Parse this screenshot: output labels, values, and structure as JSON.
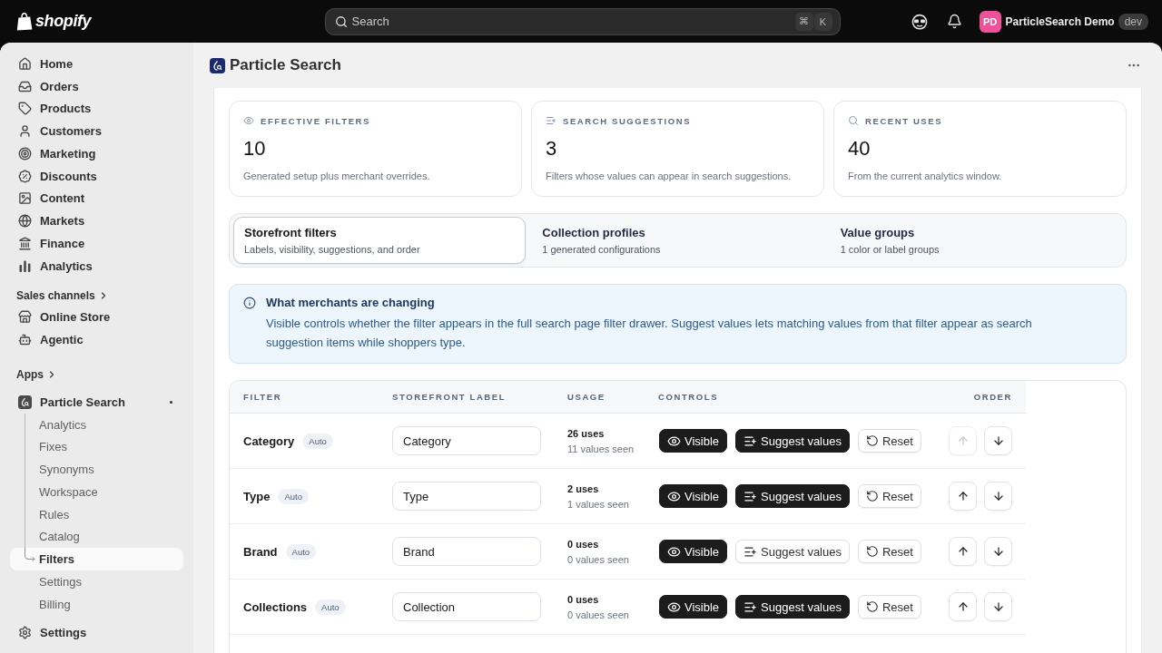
{
  "top_bar": {
    "logo": "shopify",
    "search": {
      "placeholder": "Search",
      "shortcut": [
        "⌘",
        "K"
      ]
    },
    "account": {
      "initials": "PD",
      "name": "ParticleSearch Demo",
      "badge": "dev"
    }
  },
  "sidebar": {
    "nav": [
      {
        "label": "Home",
        "selected": false
      },
      {
        "label": "Orders",
        "selected": false
      },
      {
        "label": "Products",
        "selected": false
      },
      {
        "label": "Customers",
        "selected": false
      },
      {
        "label": "Marketing",
        "selected": false
      },
      {
        "label": "Discounts",
        "selected": false
      },
      {
        "label": "Content",
        "selected": false
      },
      {
        "label": "Markets",
        "selected": false
      },
      {
        "label": "Finance",
        "selected": false
      },
      {
        "label": "Analytics",
        "selected": false
      }
    ],
    "sales_channels": {
      "heading": "Sales channels",
      "items": [
        {
          "label": "Online Store",
          "selected": false
        },
        {
          "label": "Agentic",
          "selected": false
        }
      ]
    },
    "apps": {
      "heading": "Apps",
      "items": [
        {
          "label": "Particle Search",
          "selected": false,
          "children": [
            {
              "label": "Analytics",
              "selected": false
            },
            {
              "label": "Fixes",
              "selected": false
            },
            {
              "label": "Synonyms",
              "selected": false
            },
            {
              "label": "Workspace",
              "selected": false
            },
            {
              "label": "Rules",
              "selected": false
            },
            {
              "label": "Catalog",
              "selected": false
            },
            {
              "label": "Filters",
              "selected": true
            },
            {
              "label": "Settings",
              "selected": false
            },
            {
              "label": "Billing",
              "selected": false
            }
          ]
        }
      ]
    },
    "footer": {
      "label": "Settings",
      "selected": false
    }
  },
  "page": {
    "title": "Particle Search"
  },
  "stats": [
    {
      "label": "EFFECTIVE FILTERS",
      "value": "10",
      "description": "Generated setup plus merchant overrides."
    },
    {
      "label": "SEARCH SUGGESTIONS",
      "value": "3",
      "description": "Filters whose values can appear in search suggestions."
    },
    {
      "label": "RECENT USES",
      "value": "40",
      "description": "From the current analytics window."
    }
  ],
  "tabs": [
    {
      "title": "Storefront filters",
      "subtitle": "Labels, visibility, suggestions, and order",
      "selected": true
    },
    {
      "title": "Collection profiles",
      "subtitle": "1 generated configurations",
      "selected": false
    },
    {
      "title": "Value groups",
      "subtitle": "1 color or label groups",
      "selected": false
    }
  ],
  "banner": {
    "title": "What merchants are changing",
    "body": "Visible controls whether the filter appears in the full search page filter drawer. Suggest values lets matching values from that filter appear as search suggestion items while shoppers type."
  },
  "table": {
    "columns": [
      "FILTER",
      "STOREFRONT LABEL",
      "USAGE",
      "CONTROLS",
      "ORDER"
    ],
    "rows": [
      {
        "filter": "Category",
        "badge": "Auto",
        "label": "Category",
        "uses": "26 uses",
        "values_seen": "11 values seen",
        "controls": [
          {
            "kind": "visible",
            "label": "Visible",
            "on": true
          },
          {
            "kind": "suggest",
            "label": "Suggest values",
            "on": true
          },
          {
            "kind": "reset",
            "label": "Reset"
          }
        ],
        "up_disabled": true
      },
      {
        "filter": "Type",
        "badge": "Auto",
        "label": "Type",
        "uses": "2 uses",
        "values_seen": "1 values seen",
        "controls": [
          {
            "kind": "visible",
            "label": "Visible",
            "on": true
          },
          {
            "kind": "suggest",
            "label": "Suggest values",
            "on": true
          },
          {
            "kind": "reset",
            "label": "Reset"
          }
        ],
        "up_disabled": false
      },
      {
        "filter": "Brand",
        "badge": "Auto",
        "label": "Brand",
        "uses": "0 uses",
        "values_seen": "0 values seen",
        "controls": [
          {
            "kind": "visible",
            "label": "Visible",
            "on": true
          },
          {
            "kind": "suggest",
            "label": "Suggest values",
            "on": false
          },
          {
            "kind": "reset",
            "label": "Reset"
          }
        ],
        "up_disabled": false
      },
      {
        "filter": "Collections",
        "badge": "Auto",
        "label": "Collection",
        "uses": "0 uses",
        "values_seen": "0 values seen",
        "controls": [
          {
            "kind": "visible",
            "label": "Visible",
            "on": true
          },
          {
            "kind": "suggest",
            "label": "Suggest values",
            "on": true
          },
          {
            "kind": "reset",
            "label": "Reset"
          }
        ],
        "up_disabled": false
      }
    ]
  }
}
